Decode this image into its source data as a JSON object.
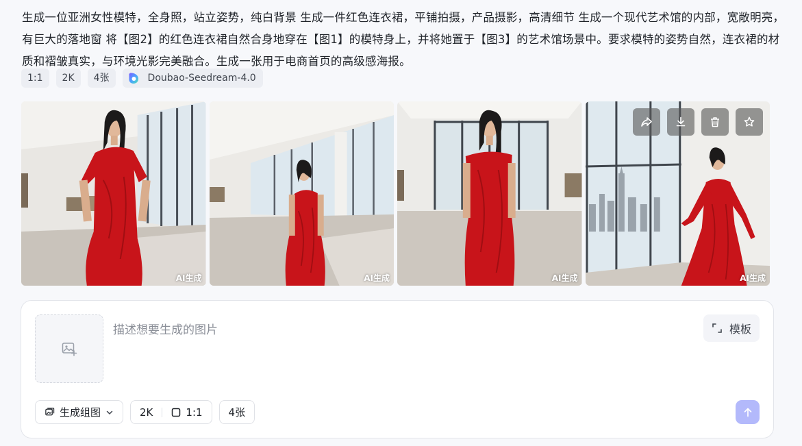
{
  "prompt_text": "生成一位亚洲女性模特，全身照，站立姿势，纯白背景 生成一件红色连衣裙，平铺拍摄，产品摄影，高清细节 生成一个现代艺术馆的内部，宽敞明亮，有巨大的落地窗 将【图2】的红色连衣裙自然合身地穿在【图1】的模特身上，并将她置于【图3】的艺术馆场景中。要求模特的姿势自然，连衣裙的材质和褶皱真实，与环境光影完美融合。生成一张用于电商首页的高级感海报。",
  "tags": {
    "ratio": "1:1",
    "resolution": "2K",
    "count": "4张",
    "model": "Doubao-Seedream-4.0"
  },
  "images": [
    {
      "label": "AI生成"
    },
    {
      "label": "AI生成"
    },
    {
      "label": "AI生成"
    },
    {
      "label": "AI生成"
    }
  ],
  "image_actions": [
    "share-icon",
    "download-icon",
    "trash-icon",
    "star-icon"
  ],
  "composer": {
    "placeholder": "描述想要生成的图片",
    "template_label": "模板",
    "mode_label": "生成组图",
    "resolution": "2K",
    "ratio": "1:1",
    "count": "4张"
  },
  "colors": {
    "accent": "#b3b9fb",
    "dress_red": "#c8141a"
  }
}
